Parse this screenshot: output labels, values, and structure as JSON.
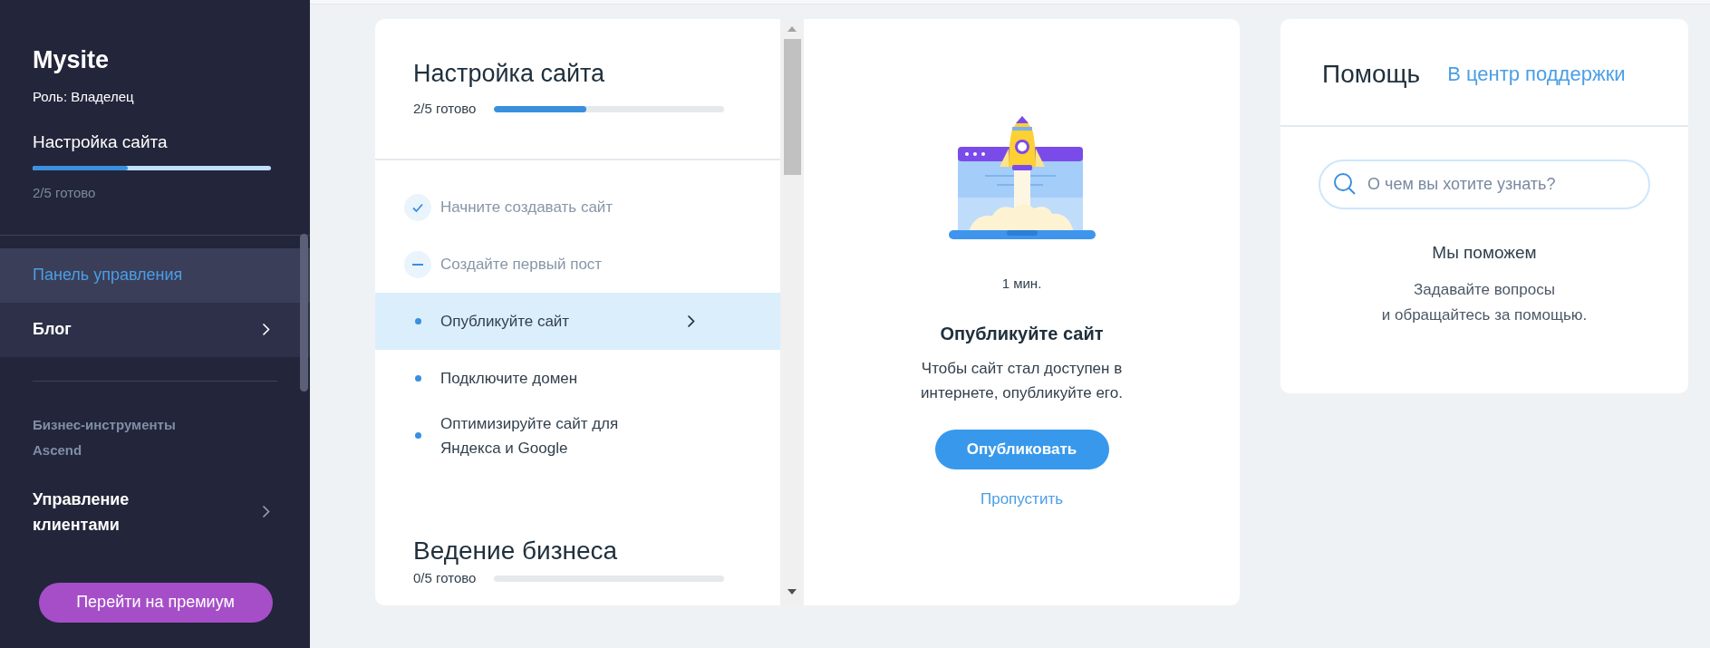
{
  "sidebar": {
    "site_name": "Mysite",
    "role": "Роль: Владелец",
    "setup": {
      "title": "Настройка сайта",
      "level": 0.4,
      "progress": "2/5 готово"
    },
    "nav": [
      {
        "label": "Панель управления",
        "selected": true,
        "has_arrow": false
      },
      {
        "label": "Блог",
        "selected": false,
        "has_arrow": true
      }
    ],
    "section_label": "Бизнес-инструменты Ascend",
    "tools": [
      {
        "label": "Управление клиентами",
        "has_arrow": true
      }
    ],
    "premium_button": "Перейти на премиум"
  },
  "checklist": {
    "title": "Настройка сайта",
    "progress": "2/5 готово",
    "level": 0.4,
    "items": [
      {
        "label": "Начните создавать сайт",
        "kind": "done",
        "selected": false
      },
      {
        "label": "Создайте первый пост",
        "kind": "skipped",
        "selected": false
      },
      {
        "label": "Опубликуйте сайт",
        "kind": "todo",
        "selected": true
      },
      {
        "label": "Подключите домен",
        "kind": "todo",
        "selected": false
      },
      {
        "label": "Оптимизируйте сайт для Яндекса и Google",
        "kind": "todo",
        "selected": false
      }
    ],
    "next_section": {
      "title": "Ведение бизнеса",
      "progress": "0/5 готово"
    }
  },
  "detail": {
    "duration": "1 мин.",
    "title": "Опубликуйте сайт",
    "description": "Чтобы сайт стал доступен в интернете, опубликуйте его.",
    "button": "Опубликовать",
    "skip": "Пропустить"
  },
  "help": {
    "title": "Помощь",
    "link": "В центр поддержки",
    "search": {
      "placeholder": "О чем вы хотите узнать?"
    },
    "heading": "Мы поможем",
    "text": "Задавайте вопросы\nи обращайтесь за помощью."
  }
}
